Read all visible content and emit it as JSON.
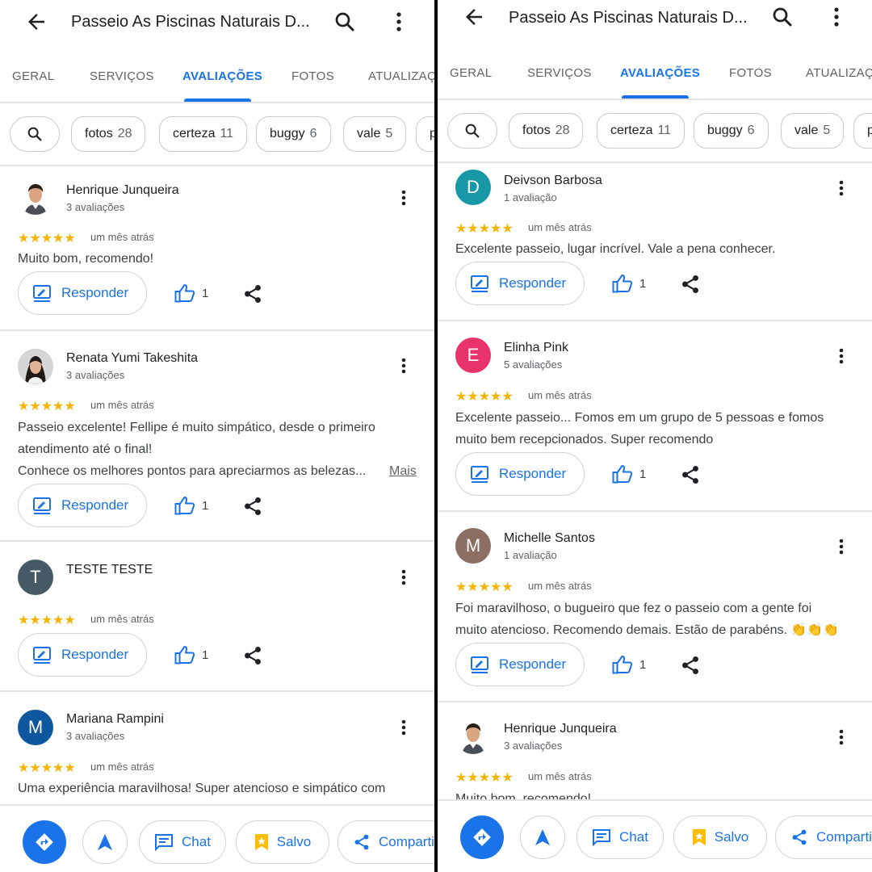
{
  "header": {
    "title": "Passeio As Piscinas Naturais D...",
    "tabs": [
      "GERAL",
      "SERVIÇOS",
      "AVALIAÇÕES",
      "FOTOS",
      "ATUALIZAÇÕES"
    ],
    "active_tab": "AVALIAÇÕES"
  },
  "chips": [
    {
      "label": "fotos",
      "count": "28"
    },
    {
      "label": "certeza",
      "count": "11"
    },
    {
      "label": "buggy",
      "count": "6"
    },
    {
      "label": "vale",
      "count": "5"
    },
    {
      "label": "p",
      "count": ""
    }
  ],
  "actions": {
    "reply": "Responder",
    "more_link": "Mais"
  },
  "colors": {
    "accent": "#1a73e8",
    "star": "#f5b400",
    "avatar_teal": "#1897a6",
    "avatar_pink": "#e8336b",
    "avatar_brown": "#8d6e63",
    "avatar_slate": "#455a64",
    "avatar_navy": "#0d579e"
  },
  "left": {
    "reviews": [
      {
        "name": "Henrique Junqueira",
        "count": "3 avaliações",
        "stars": "★★★★★",
        "date": "um mês atrás",
        "lines": [
          "Muito bom, recomendo!"
        ],
        "likes": "1",
        "avatar_type": "photo-man"
      },
      {
        "name": "Renata Yumi Takeshita",
        "count": "3 avaliações",
        "stars": "★★★★★",
        "date": "um mês atrás",
        "lines": [
          "Passeio excelente! Fellipe é muito simpático, desde o primeiro",
          "atendimento até o final!",
          "Conhece os melhores pontos para apreciarmos as belezas..."
        ],
        "likes": "1",
        "avatar_type": "photo-woman"
      },
      {
        "name": "TESTE TESTE",
        "count": "",
        "stars": "★★★★★",
        "date": "um mês atrás",
        "lines": [],
        "likes": "1",
        "initial": "T"
      },
      {
        "name": "Mariana Rampini",
        "count": "3 avaliações",
        "stars": "★★★★★",
        "date": "um mês atrás",
        "lines": [
          "Uma experiência maravilhosa! Super atencioso e simpático com"
        ],
        "initial": "M"
      }
    ]
  },
  "right": {
    "reviews": [
      {
        "name": "Deivson Barbosa",
        "count": "1 avaliação",
        "stars": "★★★★★",
        "date": "um mês atrás",
        "lines": [
          "Excelente passeio, lugar incrível. Vale a pena conhecer."
        ],
        "likes": "1",
        "initial": "D"
      },
      {
        "name": "Elinha Pink",
        "count": "5 avaliações",
        "stars": "★★★★★",
        "date": "um mês atrás",
        "lines": [
          "Excelente passeio... Fomos em um grupo de 5 pessoas e fomos",
          "muito bem recepcionados. Super recomendo"
        ],
        "likes": "1",
        "initial": "E"
      },
      {
        "name": "Michelle Santos",
        "count": "1 avaliação",
        "stars": "★★★★★",
        "date": "um mês atrás",
        "lines": [
          "Foi maravilhoso, o bugueiro que fez o passeio com a gente foi",
          "muito atencioso. Recomendo demais. Estão de parabéns. 👏👏👏"
        ],
        "likes": "1",
        "initial": "M"
      },
      {
        "name": "Henrique Junqueira",
        "count": "3 avaliações",
        "stars": "★★★★★",
        "date": "um mês atrás",
        "lines": [
          "Muito bom, recomendo!"
        ],
        "avatar_type": "photo-man"
      }
    ]
  },
  "bottom_bar": {
    "directions_icon": "directions-icon",
    "start_icon": "navigation-arrow-icon",
    "chat": "Chat",
    "saved": "Salvo",
    "share": "Compartilhar"
  }
}
